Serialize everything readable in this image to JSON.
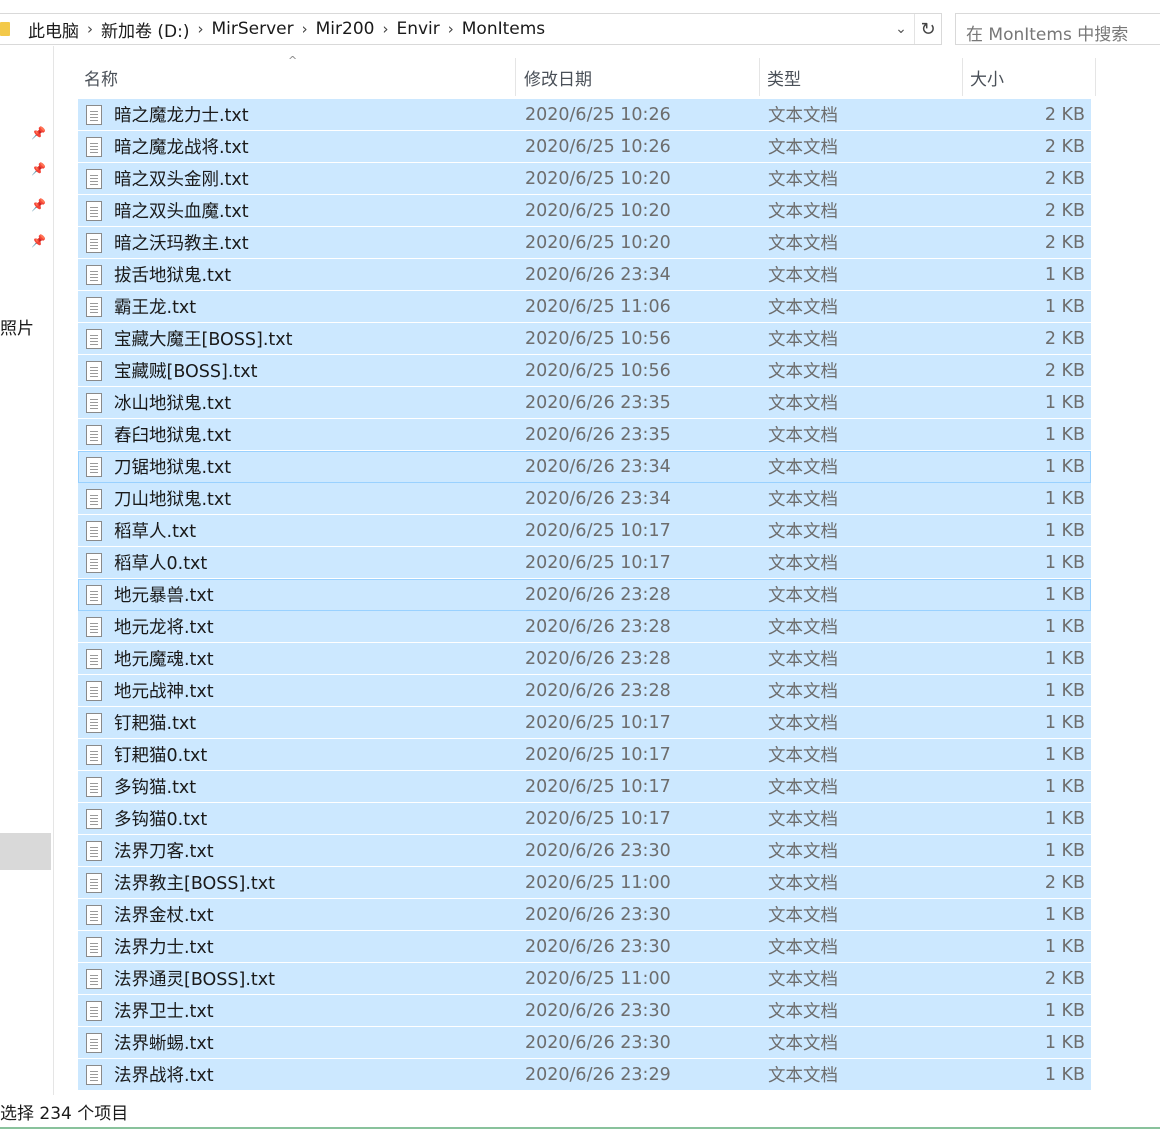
{
  "address": {
    "crumbs": [
      "此电脑",
      "新加卷 (D:)",
      "MirServer",
      "Mir200",
      "Envir",
      "MonItems"
    ]
  },
  "search": {
    "placeholder": "在 MonItems 中搜索"
  },
  "nav": {
    "label": "照片"
  },
  "columns": {
    "name": "名称",
    "date": "修改日期",
    "type": "类型",
    "size": "大小"
  },
  "files": [
    {
      "name": "暗之魔龙力士.txt",
      "date": "2020/6/25 10:26",
      "type": "文本文档",
      "size": "2 KB"
    },
    {
      "name": "暗之魔龙战将.txt",
      "date": "2020/6/25 10:26",
      "type": "文本文档",
      "size": "2 KB"
    },
    {
      "name": "暗之双头金刚.txt",
      "date": "2020/6/25 10:20",
      "type": "文本文档",
      "size": "2 KB"
    },
    {
      "name": "暗之双头血魔.txt",
      "date": "2020/6/25 10:20",
      "type": "文本文档",
      "size": "2 KB"
    },
    {
      "name": "暗之沃玛教主.txt",
      "date": "2020/6/25 10:20",
      "type": "文本文档",
      "size": "2 KB"
    },
    {
      "name": "拔舌地狱鬼.txt",
      "date": "2020/6/26 23:34",
      "type": "文本文档",
      "size": "1 KB"
    },
    {
      "name": "霸王龙.txt",
      "date": "2020/6/25 11:06",
      "type": "文本文档",
      "size": "1 KB"
    },
    {
      "name": "宝藏大魔王[BOSS].txt",
      "date": "2020/6/25 10:56",
      "type": "文本文档",
      "size": "2 KB"
    },
    {
      "name": "宝藏贼[BOSS].txt",
      "date": "2020/6/25 10:56",
      "type": "文本文档",
      "size": "2 KB"
    },
    {
      "name": "冰山地狱鬼.txt",
      "date": "2020/6/26 23:35",
      "type": "文本文档",
      "size": "1 KB"
    },
    {
      "name": "舂臼地狱鬼.txt",
      "date": "2020/6/26 23:35",
      "type": "文本文档",
      "size": "1 KB"
    },
    {
      "name": "刀锯地狱鬼.txt",
      "date": "2020/6/26 23:34",
      "type": "文本文档",
      "size": "1 KB",
      "focus": true
    },
    {
      "name": "刀山地狱鬼.txt",
      "date": "2020/6/26 23:34",
      "type": "文本文档",
      "size": "1 KB"
    },
    {
      "name": "稻草人.txt",
      "date": "2020/6/25 10:17",
      "type": "文本文档",
      "size": "1 KB"
    },
    {
      "name": "稻草人0.txt",
      "date": "2020/6/25 10:17",
      "type": "文本文档",
      "size": "1 KB"
    },
    {
      "name": "地元暴兽.txt",
      "date": "2020/6/26 23:28",
      "type": "文本文档",
      "size": "1 KB",
      "focus": true
    },
    {
      "name": "地元龙将.txt",
      "date": "2020/6/26 23:28",
      "type": "文本文档",
      "size": "1 KB"
    },
    {
      "name": "地元魔魂.txt",
      "date": "2020/6/26 23:28",
      "type": "文本文档",
      "size": "1 KB"
    },
    {
      "name": "地元战神.txt",
      "date": "2020/6/26 23:28",
      "type": "文本文档",
      "size": "1 KB"
    },
    {
      "name": "钉耙猫.txt",
      "date": "2020/6/25 10:17",
      "type": "文本文档",
      "size": "1 KB"
    },
    {
      "name": "钉耙猫0.txt",
      "date": "2020/6/25 10:17",
      "type": "文本文档",
      "size": "1 KB"
    },
    {
      "name": "多钩猫.txt",
      "date": "2020/6/25 10:17",
      "type": "文本文档",
      "size": "1 KB"
    },
    {
      "name": "多钩猫0.txt",
      "date": "2020/6/25 10:17",
      "type": "文本文档",
      "size": "1 KB"
    },
    {
      "name": "法界刀客.txt",
      "date": "2020/6/26 23:30",
      "type": "文本文档",
      "size": "1 KB"
    },
    {
      "name": "法界教主[BOSS].txt",
      "date": "2020/6/25 11:00",
      "type": "文本文档",
      "size": "2 KB"
    },
    {
      "name": "法界金杖.txt",
      "date": "2020/6/26 23:30",
      "type": "文本文档",
      "size": "1 KB"
    },
    {
      "name": "法界力士.txt",
      "date": "2020/6/26 23:30",
      "type": "文本文档",
      "size": "1 KB"
    },
    {
      "name": "法界通灵[BOSS].txt",
      "date": "2020/6/25 11:00",
      "type": "文本文档",
      "size": "2 KB"
    },
    {
      "name": "法界卫士.txt",
      "date": "2020/6/26 23:30",
      "type": "文本文档",
      "size": "1 KB"
    },
    {
      "name": "法界蜥蜴.txt",
      "date": "2020/6/26 23:30",
      "type": "文本文档",
      "size": "1 KB"
    },
    {
      "name": "法界战将.txt",
      "date": "2020/6/26 23:29",
      "type": "文本文档",
      "size": "1 KB"
    }
  ],
  "status": {
    "text": "选择 234 个项目"
  }
}
